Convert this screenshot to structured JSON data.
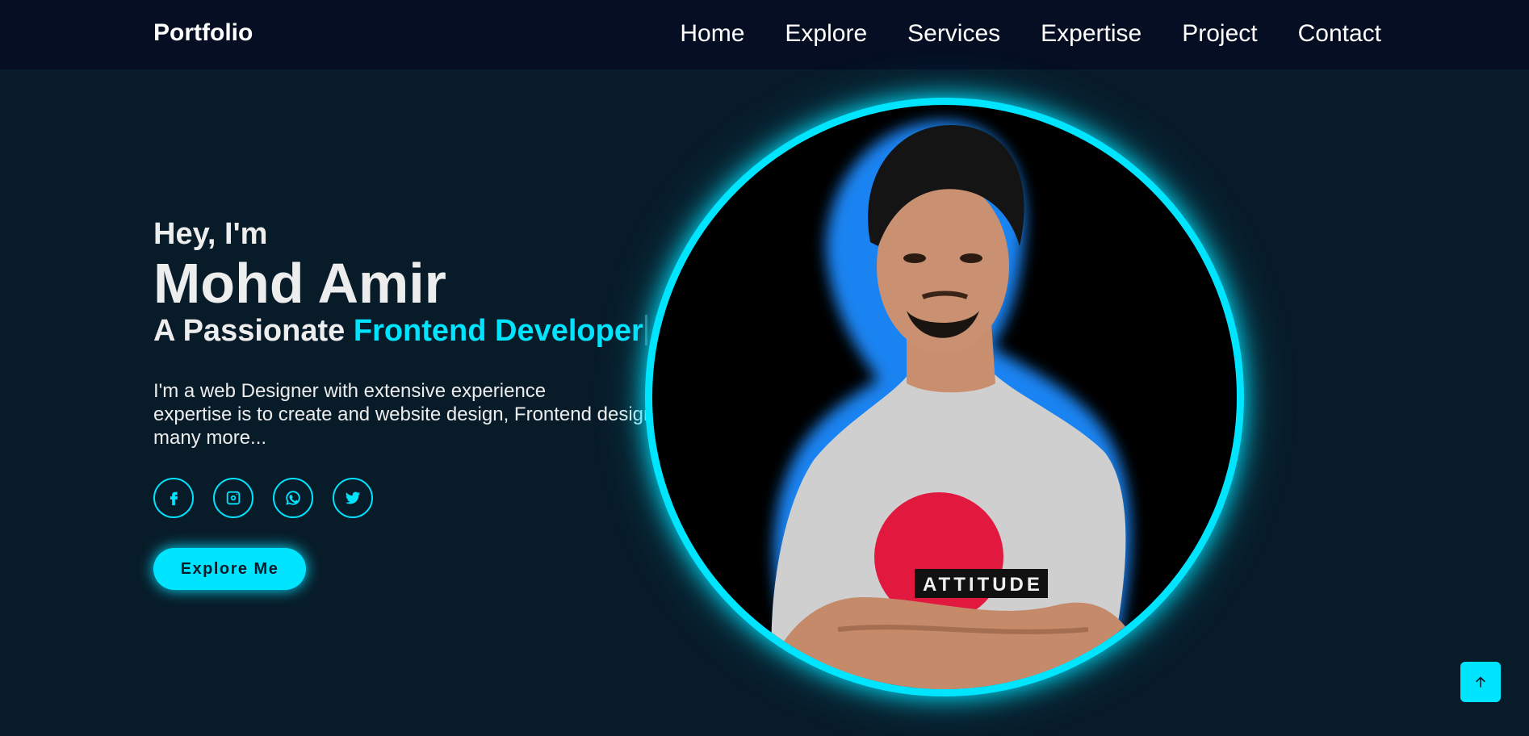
{
  "header": {
    "logo": "Portfolio",
    "nav": [
      "Home",
      "Explore",
      "Services",
      "Expertise",
      "Project",
      "Contact"
    ]
  },
  "hero": {
    "greeting": "Hey, I'm",
    "name": "Mohd Amir",
    "tagline_prefix": "A Passionate ",
    "tagline_accent": "Frontend Developer",
    "description_lines": [
      "I'm a web Designer with extensive experience",
      "expertise is to create and website design, Frontend design, and",
      "many more..."
    ],
    "cta_label": "Explore Me",
    "shirt_text": "ATTITUDE"
  },
  "socials": [
    {
      "icon": "facebook-icon"
    },
    {
      "icon": "instagram-icon"
    },
    {
      "icon": "whatsapp-icon"
    },
    {
      "icon": "twitter-icon"
    }
  ],
  "back_to_top_icon": "arrow-up-icon",
  "colors": {
    "background": "#081b29",
    "navbar": "#050e22",
    "accent": "#00e5ff",
    "text": "#ededed"
  }
}
